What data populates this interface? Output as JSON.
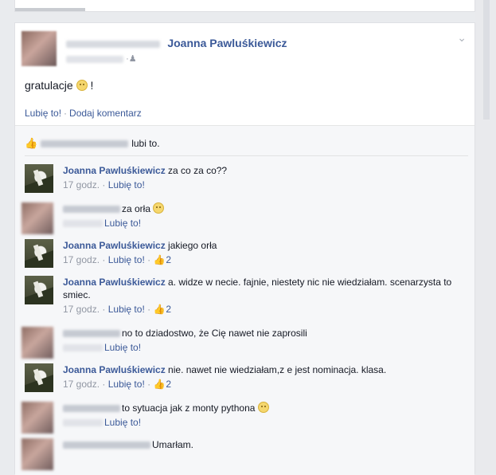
{
  "post": {
    "author": "Joanna Pawluśkiewicz",
    "text": "gratulacje",
    "text_suffix": " !",
    "actions": {
      "like": "Lubię to!",
      "separator": "·",
      "comment": "Dodaj komentarz"
    }
  },
  "likes": {
    "suffix": "lubi to."
  },
  "comments": [
    {
      "author": "Joanna Pawluśkiewicz",
      "text": " za co za co??",
      "time": "17 godz.",
      "like": "Lubię to!",
      "likes_count": ""
    },
    {
      "author": "",
      "text": "za orła",
      "time": "",
      "like": "Lubię to!",
      "likes_count": ""
    },
    {
      "author": "Joanna Pawluśkiewicz",
      "text": " jakiego orła",
      "time": "17 godz.",
      "like": "Lubię to!",
      "likes_count": "2"
    },
    {
      "author": "Joanna Pawluśkiewicz",
      "text": " a. widze w necie. fajnie, niestety nic nie wiedziałam. scenarzysta to smiec.",
      "time": "17 godz.",
      "like": "Lubię to!",
      "likes_count": "2"
    },
    {
      "author": "",
      "text": "no to dziadostwo, że Cię nawet nie zaprosili",
      "time": "",
      "like": "Lubię to!",
      "likes_count": ""
    },
    {
      "author": "Joanna Pawluśkiewicz",
      "text": " nie. nawet nie wiedziałam,z e jest nominacja. klasa.",
      "time": "17 godz.",
      "like": "Lubię to!",
      "likes_count": "2"
    },
    {
      "author": "",
      "text": "to sytuacja jak z monty pythona",
      "time": "",
      "like": "Lubię to!",
      "likes_count": ""
    },
    {
      "author": "",
      "text": "Umarłam.",
      "time": "",
      "like": "",
      "likes_count": ""
    }
  ],
  "meta_separator": "·",
  "icons": {
    "chevron": "chevron-down-icon",
    "audience": "friends-icon",
    "like_thumb": "thumbs-up-icon",
    "emoticon": "smile-emoticon-icon"
  },
  "colors": {
    "link": "#3b5998",
    "meta": "#9197a3",
    "feedback_bg": "#f6f7f9",
    "page_bg": "#e9ebee"
  }
}
